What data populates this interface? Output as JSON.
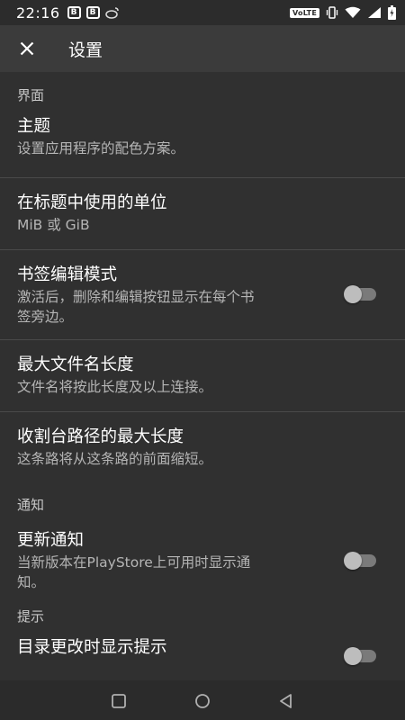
{
  "status_bar": {
    "time": "22:16",
    "notif_badges": [
      "B",
      "B"
    ],
    "volte_label": "VoLTE",
    "icons": [
      "weibo-icon",
      "vibrate-icon",
      "wifi-icon",
      "signal-icon",
      "battery-icon"
    ]
  },
  "toolbar": {
    "title": "设置",
    "close_icon": "close-icon"
  },
  "sections": {
    "interface": {
      "header": "界面",
      "theme": {
        "title": "主题",
        "summary": "设置应用程序的配色方案。"
      },
      "units": {
        "title": "在标题中使用的单位",
        "summary": "MiB 或 GiB"
      },
      "bookmark": {
        "title": "书签编辑模式",
        "summary_line1": "激活后，删除和编辑按钮显示在每个书",
        "summary_line2": "签旁边。",
        "enabled": false
      },
      "max_filename": {
        "title": "最大文件名长度",
        "summary": "文件名将按此长度及以上连接。"
      },
      "max_path": {
        "title": "收割台路径的最大长度",
        "summary": "这条路将从这条路的前面缩短。"
      }
    },
    "notifications": {
      "header": "通知",
      "update": {
        "title": "更新通知",
        "summary_line1": "当新版本在PlayStore上可用时显示通",
        "summary_line2": "知。",
        "enabled": false
      }
    },
    "tips": {
      "header": "提示",
      "show_tips": {
        "title": "目录更改时显示提示",
        "enabled": false
      }
    }
  },
  "nav_bar": {
    "icons": [
      "recents-icon",
      "home-icon",
      "back-icon"
    ]
  }
}
